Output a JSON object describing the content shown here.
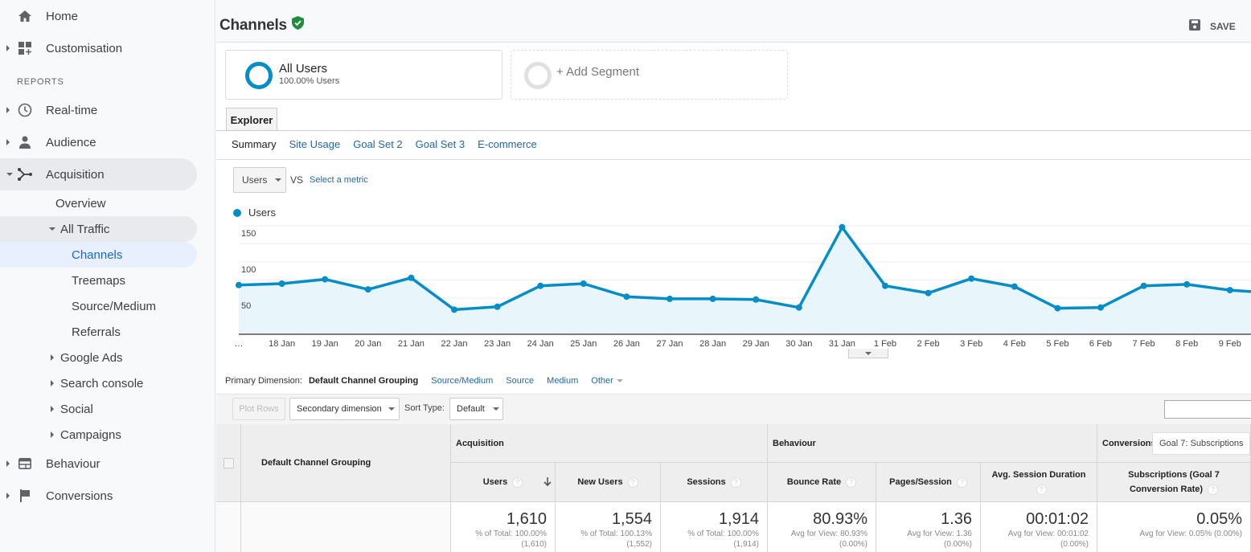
{
  "sidebar": {
    "home": "Home",
    "customisation": "Customisation",
    "reports_heading": "REPORTS",
    "realtime": "Real-time",
    "audience": "Audience",
    "acquisition": "Acquisition",
    "acquisition_children": {
      "overview": "Overview",
      "all_traffic": "All Traffic",
      "channels": "Channels",
      "treemaps": "Treemaps",
      "source_medium": "Source/Medium",
      "referrals": "Referrals",
      "google_ads": "Google Ads",
      "search_console": "Search console",
      "social": "Social",
      "campaigns": "Campaigns"
    },
    "behaviour": "Behaviour",
    "conversions": "Conversions"
  },
  "header": {
    "title": "Channels",
    "save_label": "SAVE"
  },
  "segments": {
    "active": {
      "name": "All Users",
      "sub": "100.00% Users"
    },
    "add_label": "+ Add Segment"
  },
  "explorer": {
    "tab": "Explorer",
    "subtabs": [
      "Summary",
      "Site Usage",
      "Goal Set 2",
      "Goal Set 3",
      "E-commerce"
    ]
  },
  "metric_picker": {
    "selected": "Users",
    "vs": "VS",
    "select_metric": "Select a metric"
  },
  "colors": {
    "series": "#058dc7",
    "area": "#e6f4fa",
    "link": "#2266aa",
    "verified": "#1e8e3e"
  },
  "chart_data": {
    "type": "area",
    "title": "",
    "xlabel": "",
    "ylabel": "",
    "ylim": [
      0,
      150
    ],
    "yticks": [
      50,
      100,
      150
    ],
    "grid": true,
    "legend": "top-left",
    "categories": [
      "…",
      "18 Jan",
      "19 Jan",
      "20 Jan",
      "21 Jan",
      "22 Jan",
      "23 Jan",
      "24 Jan",
      "25 Jan",
      "26 Jan",
      "27 Jan",
      "28 Jan",
      "29 Jan",
      "30 Jan",
      "31 Jan",
      "1 Feb",
      "2 Feb",
      "3 Feb",
      "4 Feb",
      "5 Feb",
      "6 Feb",
      "7 Feb",
      "8 Feb",
      "9 Feb",
      ""
    ],
    "series": [
      {
        "name": "Users",
        "values": [
          68,
          70,
          76,
          62,
          78,
          34,
          38,
          67,
          70,
          52,
          49,
          49,
          48,
          37,
          148,
          67,
          57,
          77,
          66,
          36,
          37,
          67,
          69,
          61,
          57
        ]
      }
    ]
  },
  "dimension_bar": {
    "label": "Primary Dimension:",
    "active": "Default Channel Grouping",
    "links": [
      "Source/Medium",
      "Source",
      "Medium",
      "Other"
    ]
  },
  "toolbar": {
    "plot_rows": "Plot Rows",
    "secondary_dimension": "Secondary dimension",
    "sort_type_label": "Sort Type:",
    "sort_type_value": "Default",
    "search_value": ""
  },
  "table": {
    "dimension_header": "Default Channel Grouping",
    "groups": {
      "acquisition": "Acquisition",
      "behaviour": "Behaviour",
      "conversions": "Conversions",
      "goal_select": "Goal 7: Subscriptions"
    },
    "columns": [
      {
        "label": "Users",
        "value": "1,610",
        "sub1": "% of Total: 100.00%",
        "sub2": "(1,610)"
      },
      {
        "label": "New Users",
        "value": "1,554",
        "sub1": "% of Total: 100.13%",
        "sub2": "(1,552)"
      },
      {
        "label": "Sessions",
        "value": "1,914",
        "sub1": "% of Total: 100.00%",
        "sub2": "(1,914)"
      },
      {
        "label": "Bounce Rate",
        "value": "80.93%",
        "sub1": "Avg for View: 80.93%",
        "sub2": "(0.00%)"
      },
      {
        "label": "Pages/Session",
        "value": "1.36",
        "sub1": "Avg for View: 1.36",
        "sub2": "(0.00%)"
      },
      {
        "label": "Avg. Session Duration",
        "value": "00:01:02",
        "sub1": "Avg for View: 00:01:02",
        "sub2": "(0.00%)"
      },
      {
        "label": "Subscriptions (Goal 7 Conversion Rate)",
        "value": "0.05%",
        "sub1": "Avg for View: 0.05% (0.00%)",
        "sub2": ""
      }
    ],
    "help_glyph": "?"
  }
}
